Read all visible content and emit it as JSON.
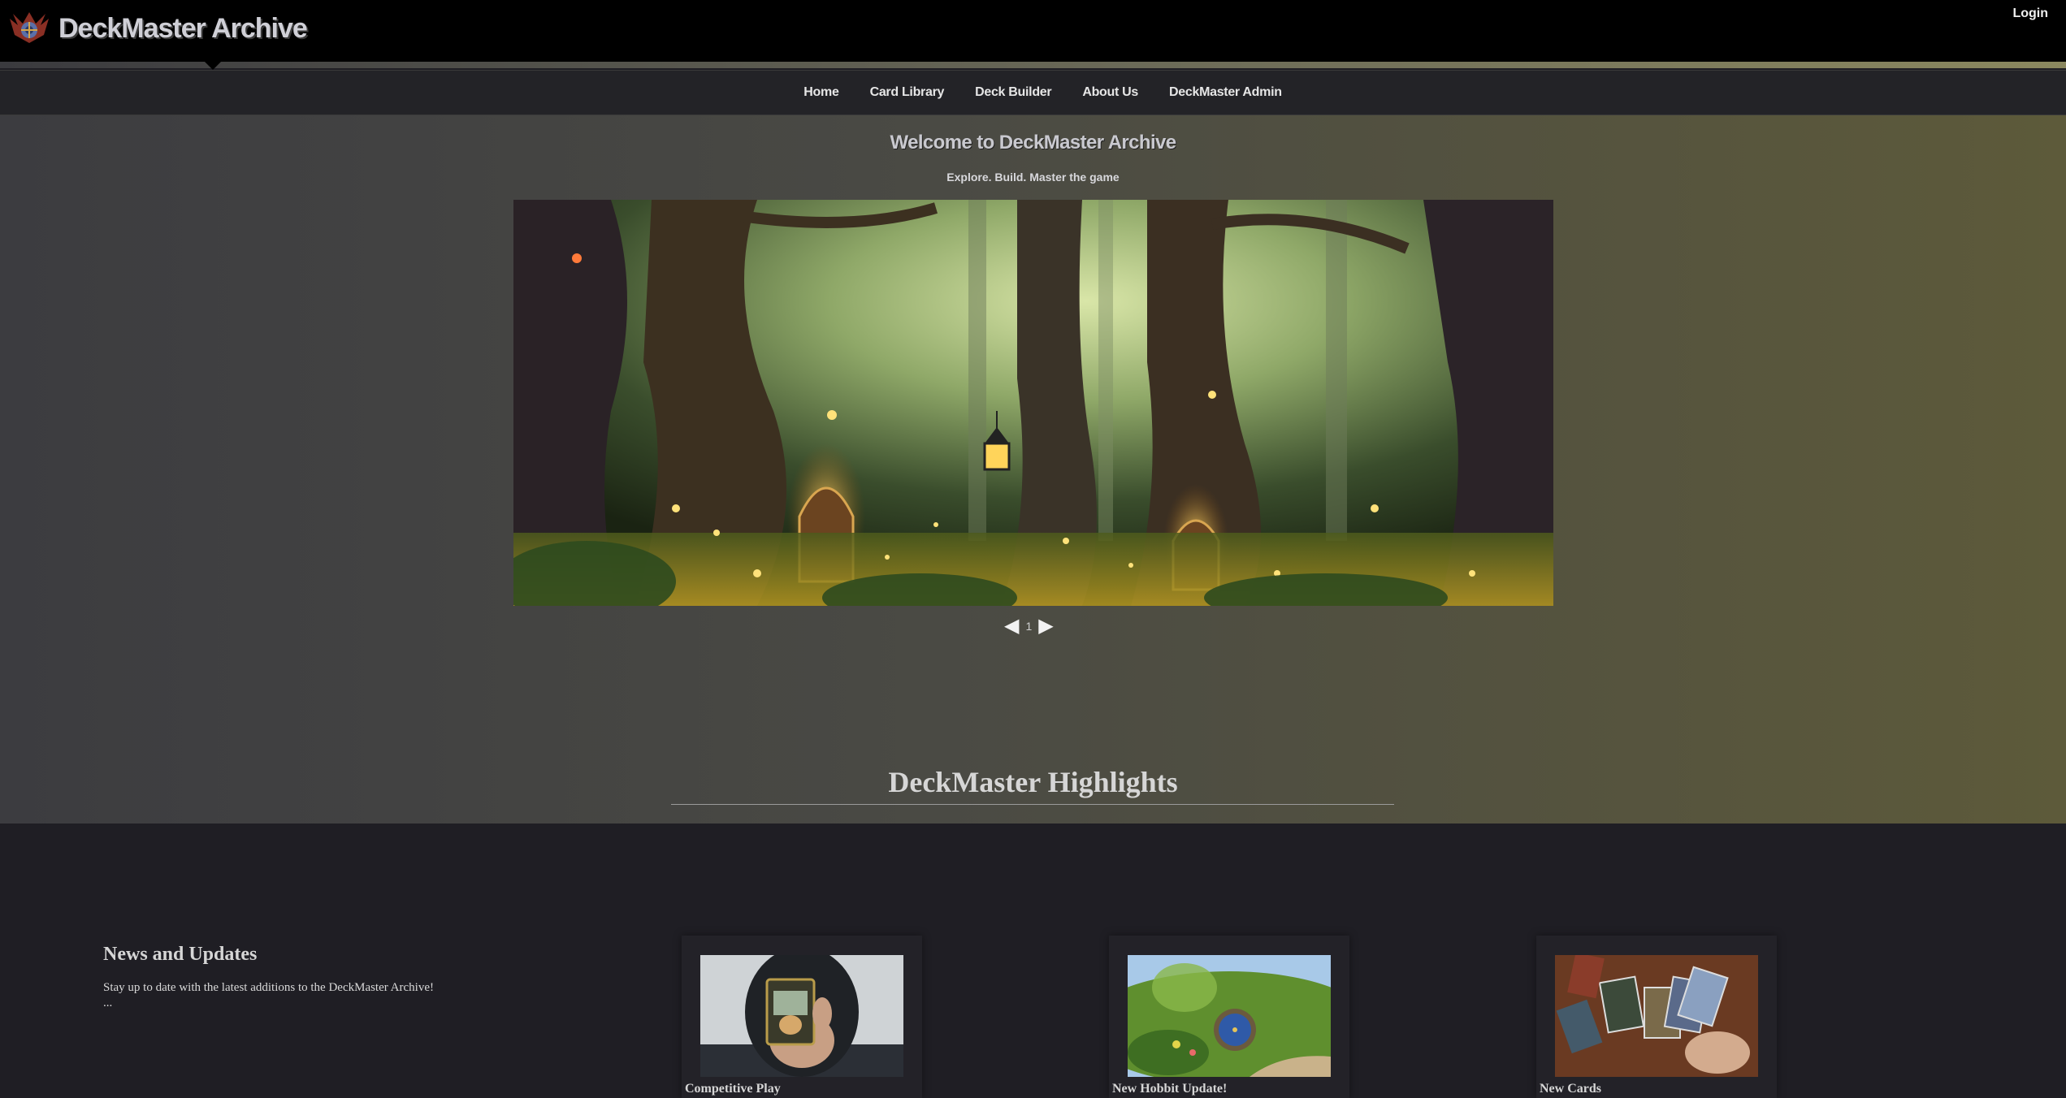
{
  "header": {
    "brand_title": "DeckMaster Archive",
    "login_label": "Login"
  },
  "nav": {
    "items": [
      "Home",
      "Card Library",
      "Deck Builder",
      "About Us",
      "DeckMaster Admin"
    ]
  },
  "hero": {
    "title": "Welcome to DeckMaster Archive",
    "subtitle": "Explore. Build. Master the game",
    "pager": {
      "prev": "◀",
      "page": "1",
      "next": "▶"
    }
  },
  "highlights": {
    "title": "DeckMaster Highlights"
  },
  "news": {
    "title": "News and Updates",
    "text": "Stay up to date with the latest additions to the DeckMaster Archive! ..."
  },
  "cards": [
    {
      "label": "Competitive Play",
      "image": "person-holding-card"
    },
    {
      "label": "New Hobbit Update!",
      "image": "hobbit-hole"
    },
    {
      "label": "New Cards",
      "image": "hand-of-cards"
    }
  ],
  "colors": {
    "topbar": "#000000",
    "nav_bg": "#232327",
    "hero_left": "#3c3c40",
    "hero_right": "#5d5a3a",
    "page_bg": "#1f1e24"
  }
}
